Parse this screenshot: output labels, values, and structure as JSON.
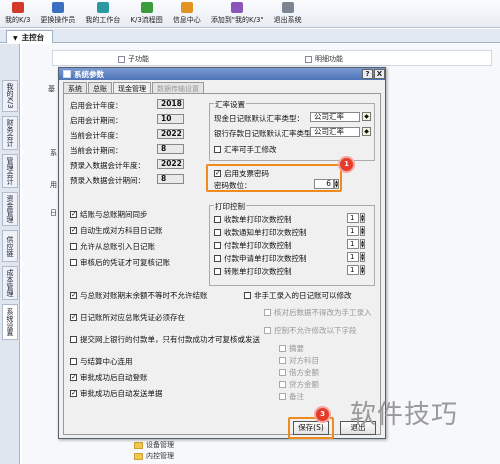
{
  "toolbar": {
    "items": [
      {
        "label": "我的K/3",
        "icon": "home-icon"
      },
      {
        "label": "更换操作员",
        "icon": "user-switch-icon"
      },
      {
        "label": "我的工作台",
        "icon": "desktop-icon"
      },
      {
        "label": "K/3流程图",
        "icon": "flowchart-icon"
      },
      {
        "label": "信息中心",
        "icon": "info-icon"
      },
      {
        "label": "添加到\"我的K/3\"",
        "icon": "add-favorite-icon"
      },
      {
        "label": "退出系统",
        "icon": "exit-icon"
      }
    ]
  },
  "tabstrip": {
    "main_tab": "主控台"
  },
  "side_tabs": [
    "我的K/3",
    "财务会计",
    "管理会计",
    "资金管理",
    "供应链",
    "成本管理",
    "系统设置"
  ],
  "workspace": {
    "header_items": [
      "子功能",
      "明细功能"
    ],
    "left_labels": [
      "基",
      "系",
      "用",
      "日"
    ],
    "bottom_items": [
      "设备管理",
      "内控管理"
    ]
  },
  "dialog": {
    "title": "系统参数",
    "help_button": "?",
    "close_button": "X",
    "tabs": [
      {
        "label": "系统",
        "state": "normal"
      },
      {
        "label": "总账",
        "state": "normal"
      },
      {
        "label": "现金管理",
        "state": "active"
      },
      {
        "label": "数据传输设置",
        "state": "disabled"
      }
    ],
    "period": {
      "start_year_label": "启用会计年度：",
      "start_year": "2018",
      "start_period_label": "启用会计期间：",
      "start_period": "10",
      "current_year_label": "当前会计年度：",
      "current_year": "2022",
      "current_period_label": "当前会计期间：",
      "current_period": "8",
      "preset_year_label": "预录入数据会计年度：",
      "preset_year": "2022",
      "preset_period_label": "预录入数据会计期间：",
      "preset_period": "8"
    },
    "rate": {
      "group_title": "汇率设置",
      "cash_label": "现金日记账默认汇率类型：",
      "cash_value": "公司汇率",
      "bank_label": "银行存款日记账默认汇率类型：",
      "bank_value": "公司汇率",
      "manual_label": "汇率可手工修改"
    },
    "password": {
      "enable_label": "启用支票密码",
      "digits_label": "密码数位：",
      "digits_value": "6"
    },
    "left_options": [
      {
        "label": "结账与总账期间同步",
        "checked": true
      },
      {
        "label": "自动生成对方科目日记账",
        "checked": true
      },
      {
        "label": "允许从总账引入日记账",
        "checked": false
      },
      {
        "label": "审核后的凭证才可复核记账",
        "checked": false
      },
      {
        "label": "与总账对账期末余额不等时不允许结账",
        "checked": true
      },
      {
        "label": "日记账所对应总账凭证必须存在",
        "checked": true
      },
      {
        "label": "提交网上银行的付款单，只有付款成功才可复核或发送",
        "checked": false
      },
      {
        "label": "与结算中心连用",
        "checked": false
      },
      {
        "label": "审批成功后自动登账",
        "checked": true
      },
      {
        "label": "审批成功后自动发送单据",
        "checked": true
      }
    ],
    "print": {
      "group_title": "打印控制",
      "items": [
        "收款单打印次数控制",
        "收款通知单打印次数控制",
        "付款单打印次数控制",
        "付款申请单打印次数控制",
        "转账单打印次数控制"
      ],
      "counts": [
        "1",
        "1",
        "1",
        "1",
        "1"
      ]
    },
    "right_options": {
      "manual_edit": "非手工录入的日记账可以修改",
      "balance_check": "核对后数据不得改为手工录入",
      "import_control": "控制不允许修改以下字段",
      "fields": [
        "摘要",
        "对方科目",
        "借方金额",
        "贷方金额",
        "备注"
      ]
    },
    "buttons": {
      "save": "保存(S)",
      "exit": "退出"
    },
    "step_badges": [
      "1",
      "3"
    ]
  },
  "watermark": "软件技巧",
  "colors": {
    "highlight": "#ef8a1f",
    "badge": "#e53b2b",
    "title_bar": "#4c72b8"
  }
}
